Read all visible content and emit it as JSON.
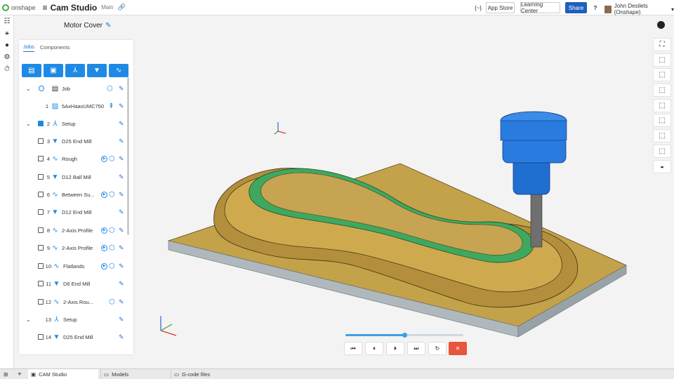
{
  "header": {
    "logo": "onshape",
    "app_title": "Cam Studio",
    "branch": "Main",
    "buttons": {
      "code": "{~}",
      "app_store": "App Store",
      "learning_center": "Learning Center",
      "share": "Share",
      "help": "?"
    },
    "user": "John Desilets (Onshape)"
  },
  "document": {
    "title": "Motor Cover"
  },
  "panel": {
    "tabs": [
      "Jobs",
      "Components"
    ],
    "rows": [
      {
        "num": "",
        "label": "Job"
      },
      {
        "num": "1",
        "label": "5AxHaasUMC750"
      },
      {
        "num": "2",
        "label": "Setup"
      },
      {
        "num": "3",
        "label": "D25 End Mill"
      },
      {
        "num": "4",
        "label": "Rough"
      },
      {
        "num": "5",
        "label": "D12 Ball Mill"
      },
      {
        "num": "6",
        "label": "Between Su..."
      },
      {
        "num": "7",
        "label": "D12 End Mill"
      },
      {
        "num": "8",
        "label": "2-Axis Profile"
      },
      {
        "num": "9",
        "label": "2-Axis Profile"
      },
      {
        "num": "10",
        "label": "Flatlands"
      },
      {
        "num": "11",
        "label": "D6 End Mill"
      },
      {
        "num": "12",
        "label": "2-Axis Rou..."
      },
      {
        "num": "13",
        "label": "Setup"
      },
      {
        "num": "14",
        "label": "D25 End Mill"
      }
    ]
  },
  "simulation": {
    "progress": 0.5
  },
  "bottom_tabs": [
    "CAM Studio",
    "Models",
    "G-code files"
  ],
  "colors": {
    "accent": "#1f8ae6",
    "share": "#1f5fbd",
    "stock": "#c4a24a",
    "finished": "#3fa860",
    "tool": "#1f6fd1",
    "stop": "#e8553d"
  }
}
